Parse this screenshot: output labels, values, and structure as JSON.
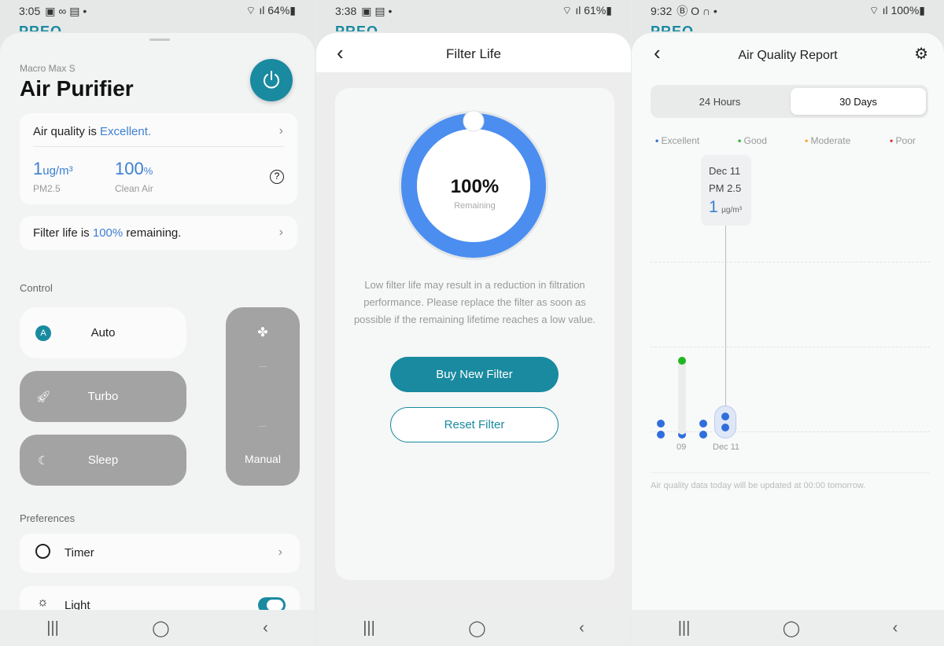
{
  "panel1": {
    "status": {
      "time": "3:05",
      "battery": "64%"
    },
    "brand": "PREO",
    "model": "Macro Max S",
    "title": "Air Purifier",
    "air_quality": {
      "prefix": "Air quality is",
      "value": "Excellent.",
      "pm_value": "1",
      "pm_unit": "ug/m³",
      "pm_label": "PM2.5",
      "clean_value": "100",
      "clean_unit": "%",
      "clean_label": "Clean Air"
    },
    "filter": {
      "prefix": "Filter life is",
      "value": "100%",
      "suffix": "remaining."
    },
    "control_label": "Control",
    "modes": [
      {
        "label": "Auto",
        "icon": "auto-icon",
        "active": true
      },
      {
        "label": "Turbo",
        "icon": "rocket-icon"
      },
      {
        "label": "Sleep",
        "icon": "moon-icon"
      }
    ],
    "manual_label": "Manual",
    "preferences_label": "Preferences",
    "timer_label": "Timer",
    "light_label": "Light",
    "light_on": true,
    "accent": "#1a8aa0"
  },
  "panel2": {
    "status": {
      "time": "3:38",
      "battery": "61%"
    },
    "brand": "PREO",
    "title": "Filter Life",
    "percent": "100%",
    "remaining_label": "Remaining",
    "filter_fraction": 1.0,
    "notice": "Low filter life may result in a reduction in filtration performance. Please replace the filter as soon as possible if the remaining lifetime reaches a low value.",
    "buy_label": "Buy New Filter",
    "reset_label": "Reset Filter",
    "ring_color": "#4b8ef0"
  },
  "panel3": {
    "status": {
      "time": "9:32",
      "battery": "100%"
    },
    "brand": "PREO",
    "title": "Air Quality Report",
    "tabs": [
      {
        "label": "24 Hours"
      },
      {
        "label": "30 Days",
        "active": true
      }
    ],
    "legend": [
      {
        "label": "Excellent",
        "color": "#2f6fdc"
      },
      {
        "label": "Good",
        "color": "#22b522"
      },
      {
        "label": "Moderate",
        "color": "#f0a530"
      },
      {
        "label": "Poor",
        "color": "#d83a3a"
      }
    ],
    "tooltip": {
      "date": "Dec 11",
      "metric": "PM 2.5",
      "value": "1",
      "unit": "µg/m³"
    },
    "x_labels": [
      "09",
      "Dec 11"
    ],
    "days": [
      {
        "levels": [
          "Excellent",
          "Excellent"
        ]
      },
      {
        "levels": [
          "Excellent",
          "Good"
        ]
      },
      {
        "levels": [
          "Excellent",
          "Excellent"
        ]
      },
      {
        "levels": [
          "Excellent",
          "Excellent"
        ],
        "selected": true
      }
    ],
    "footnote": "Air quality data today will be updated at 00:00 tomorrow."
  },
  "nav": {
    "recent": "|||",
    "home": "◯",
    "back": "‹"
  }
}
